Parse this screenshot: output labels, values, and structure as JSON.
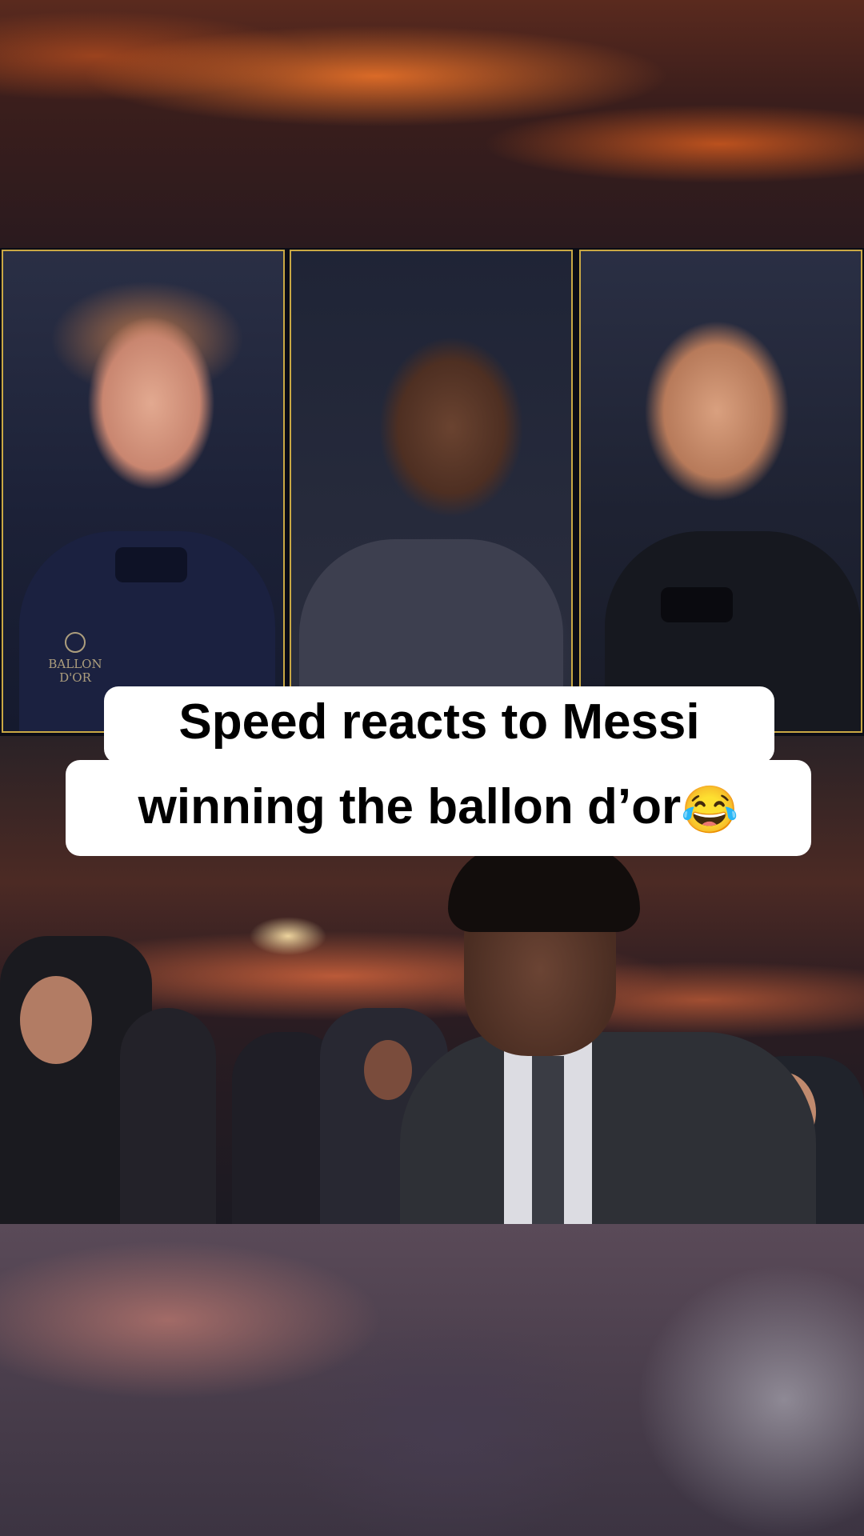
{
  "overlay": {
    "logo_line1": "BALLON",
    "logo_line2": "D'OR"
  },
  "caption": {
    "line1": "Speed reacts to Messi",
    "line2": "winning the ballon d’or",
    "emoji": "😂"
  },
  "colors": {
    "panel_border": "#c9a844",
    "caption_bg": "#ffffff",
    "caption_text": "#000000"
  }
}
